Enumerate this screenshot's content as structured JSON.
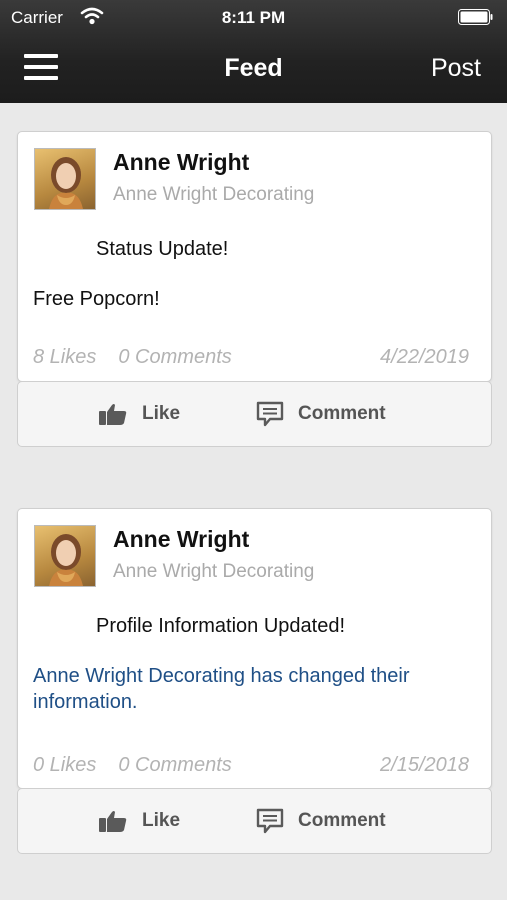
{
  "status_bar": {
    "carrier": "Carrier",
    "time": "8:11 PM"
  },
  "nav": {
    "title": "Feed",
    "post_label": "Post",
    "menu_icon": "hamburger-menu-icon"
  },
  "feed": [
    {
      "author": "Anne Wright",
      "company": "Anne Wright Decorating",
      "title": "Status Update!",
      "body": "Free Popcorn!",
      "likes": "8 Likes",
      "comments": "0 Comments",
      "date": "4/22/2019",
      "like_label": "Like",
      "comment_label": "Comment"
    },
    {
      "author": "Anne Wright",
      "company": "Anne Wright Decorating",
      "title": "Profile Information Updated!",
      "body": "Anne Wright Decorating has changed their information.",
      "likes": "0 Likes",
      "comments": "0 Comments",
      "date": "2/15/2018",
      "like_label": "Like",
      "comment_label": "Comment"
    }
  ],
  "colors": {
    "header_bg": "#222222",
    "page_bg": "#e9e9e9",
    "link_text": "#1f4f86",
    "muted_text": "#b3b3b3"
  }
}
